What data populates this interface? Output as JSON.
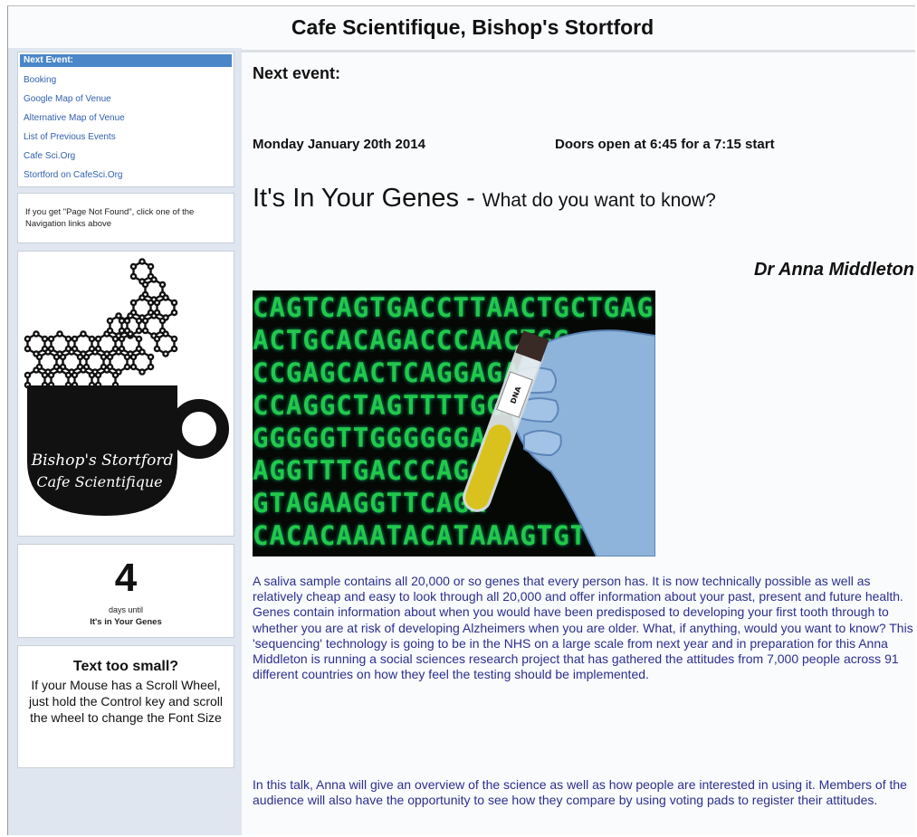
{
  "site": {
    "title": "Cafe Scientifique, Bishop's Stortford"
  },
  "sidebar": {
    "nav": [
      {
        "label": "Next Event:"
      },
      {
        "label": "Booking"
      },
      {
        "label": "Google Map of Venue"
      },
      {
        "label": "Alternative Map of Venue"
      },
      {
        "label": "List of Previous Events"
      },
      {
        "label": "Cafe Sci.Org"
      },
      {
        "label": "Stortford on CafeSci.Org"
      }
    ],
    "notice": "If you get \"Page Not Found\", click one of the Navigation links above",
    "logo": {
      "line1": "Bishop's Stortford",
      "line2": "Cafe Scientifique"
    },
    "countdown": {
      "number": "4",
      "label": "days until",
      "event": "It's in Your Genes"
    },
    "tip": {
      "heading": "Text too small?",
      "body": "If your Mouse has a Scroll Wheel, just hold the Control key and scroll the wheel to change the Font Size"
    }
  },
  "main": {
    "next_label": "Next event:",
    "date": "Monday January 20th 2014",
    "doors": "Doors open at 6:45 for a 7:15 start",
    "title_main": "It's In Your Genes - ",
    "title_sub": "What do you want to know?",
    "speaker": "Dr Anna Middleton",
    "image": {
      "sequence_lines": [
        "CAGTCAGTGACCTTAACTGCTGAG",
        "ACTGCACAGACCCAACTGG",
        "CCGAGCACTCAGGAGA",
        "CCAGGCTAGTTTTGGAG",
        "GGGGGTTGGGGGGAC",
        "AGGTTTGACCCAGC",
        "GTAGAAGGTTCAGA",
        "CACACAAATACATAAAGTGTGTC"
      ],
      "tube_label": "DNA"
    },
    "description": "A saliva sample contains all 20,000 or so genes that every person has. It is now technically possible as well as relatively cheap and easy to look through all 20,000 and offer information about your past, present and future health. Genes contain information about when you would have been predisposed to developing your first tooth through to whether you are at risk of developing Alzheimers when you are older. What, if anything,  would you want to know? This 'sequencing' technology is going to be in the NHS on a large scale from next year and in preparation for this Anna Middleton is running a social sciences research project that has gathered the attitudes from 7,000 people across 91 different countries on how they feel the testing should be implemented.",
    "description2": "In this talk, Anna will give an overview of the science as well as how people are interested in using it. Members of the audience will also have the opportunity to see how they compare by using voting pads to register their attitudes."
  }
}
